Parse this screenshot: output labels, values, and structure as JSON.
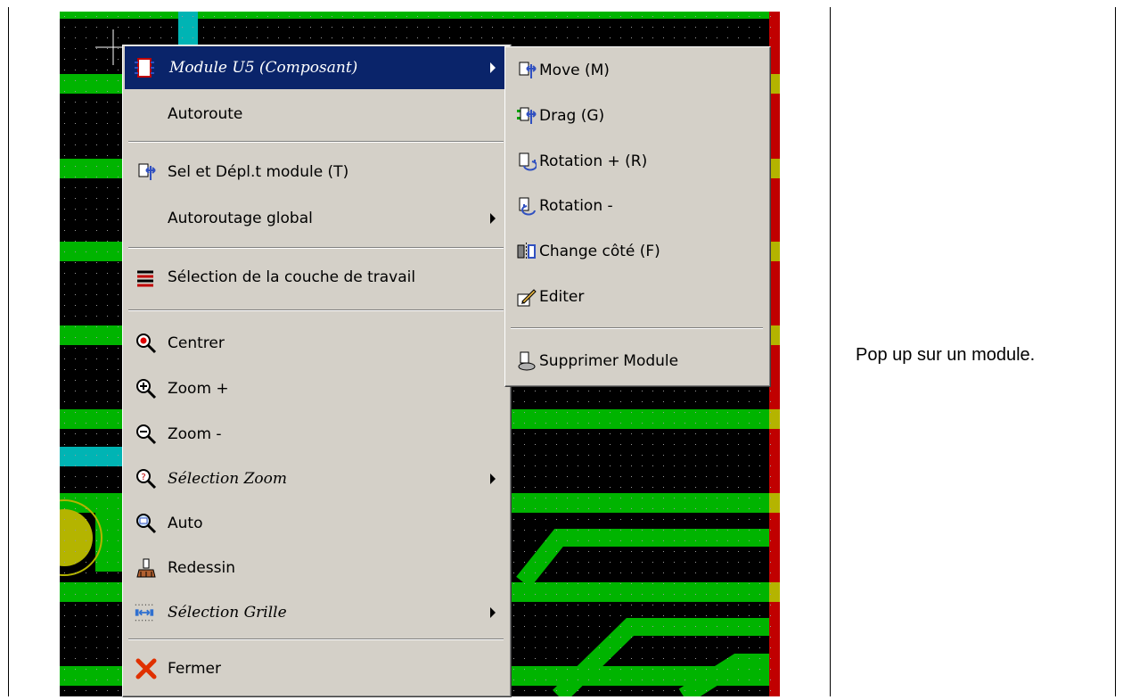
{
  "main_menu": {
    "items": [
      {
        "label": "Module U5 (Composant)",
        "icon": "module-chip-icon",
        "submenu": true,
        "selected": true,
        "italic": true
      },
      {
        "label": "Autoroute",
        "icon": null
      },
      {
        "label": "Sel et Dépl.t module (T)",
        "icon": "move-module-icon"
      },
      {
        "label": "Autoroutage global",
        "icon": null,
        "submenu": true
      },
      {
        "label": "Sélection de la couche de travail",
        "icon": "layers-icon"
      },
      {
        "label": "Centrer",
        "icon": "zoom-center-icon"
      },
      {
        "label": "Zoom +",
        "icon": "zoom-in-icon"
      },
      {
        "label": "Zoom -",
        "icon": "zoom-out-icon"
      },
      {
        "label": "Sélection Zoom",
        "icon": "zoom-select-icon",
        "submenu": true,
        "italic": true
      },
      {
        "label": "Auto",
        "icon": "zoom-auto-icon"
      },
      {
        "label": "Redessin",
        "icon": "redraw-brush-icon"
      },
      {
        "label": "Sélection Grille",
        "icon": "grid-select-icon",
        "submenu": true,
        "italic": true
      },
      {
        "label": "Fermer",
        "icon": "close-x-icon"
      }
    ]
  },
  "sub_menu": {
    "items": [
      {
        "label": "Move (M)",
        "icon": "move-icon"
      },
      {
        "label": "Drag (G)",
        "icon": "drag-icon"
      },
      {
        "label": "Rotation + (R)",
        "icon": "rotate-plus-icon"
      },
      {
        "label": "Rotation -",
        "icon": "rotate-minus-icon"
      },
      {
        "label": "Change côté (F)",
        "icon": "flip-side-icon"
      },
      {
        "label": "Editer",
        "icon": "edit-pencil-icon"
      },
      {
        "label": "Supprimer Module",
        "icon": "delete-module-icon"
      }
    ]
  },
  "caption": "Pop up sur un module.",
  "colors": {
    "menu_bg": "#d4d0c8",
    "selection": "#0a246a",
    "track_green": "#00c000",
    "via_cyan": "#00c0c0",
    "edge_red": "#c00000",
    "pad_yellow": "#c0c000"
  }
}
